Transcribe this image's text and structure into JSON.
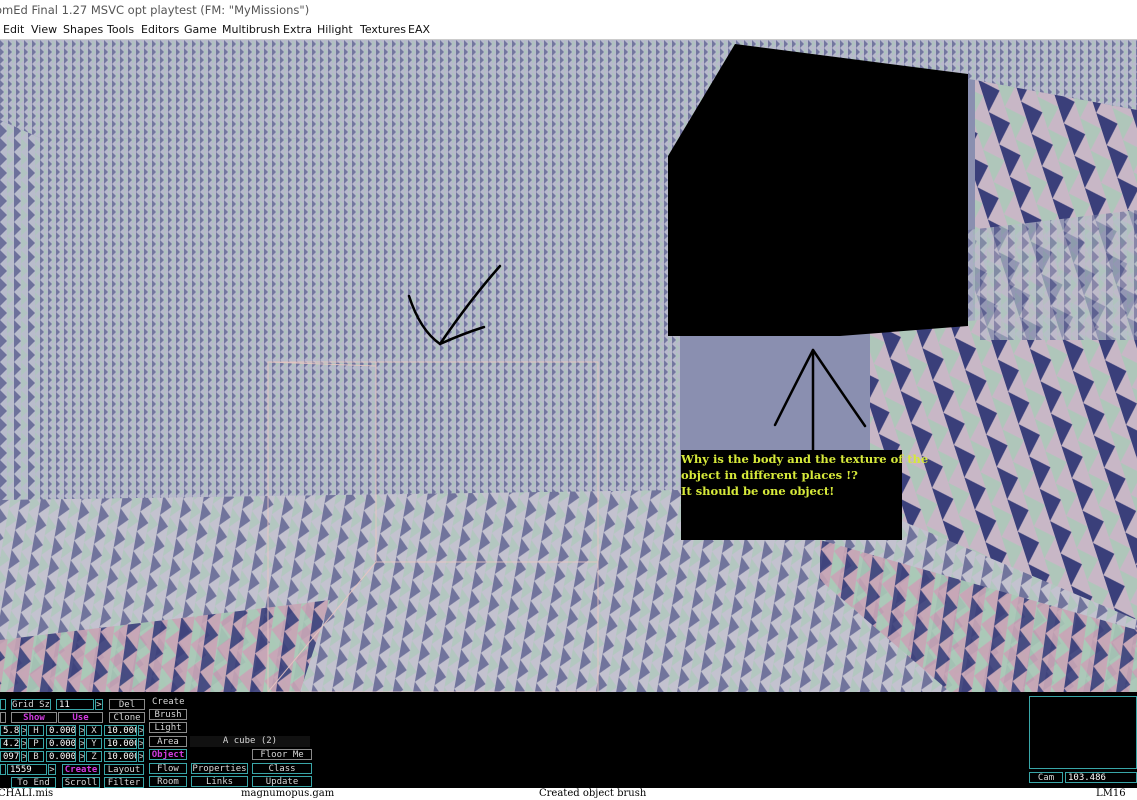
{
  "window": {
    "title": "omEd Final 1.27 MSVC opt playtest (FM: \"MyMissions\")"
  },
  "menu": [
    "Edit",
    "View",
    "Shapes",
    "Tools",
    "Editors",
    "Game",
    "Multibrush",
    "Extra",
    "Hilight",
    "Textures",
    "EAX"
  ],
  "annotation": {
    "line1": "Why is the body and the texture of the",
    "line2": "object in different places !?",
    "line3": "It should be one object!"
  },
  "panel": {
    "grid_label": "Grid Sz",
    "grid_value": "11",
    "del": "Del",
    "show": "Show",
    "use": "Use",
    "clone": "Clone",
    "pos_x": "5.827",
    "pos_y": "4.20",
    "pos_z": "097",
    "rot_h": "0.000",
    "rot_p": "0.000",
    "rot_b": "0.000",
    "rot_h_label": "H",
    "rot_p_label": "P",
    "rot_b_label": "B",
    "scale_x": "10.000",
    "scale_y": "10.000",
    "scale_z": "10.000",
    "scale_x_label": "X",
    "scale_y_label": "Y",
    "scale_z_label": "Z",
    "arrow": ">",
    "brush_num": "1559",
    "create_top": "Create",
    "brush": "Brush",
    "light": "Light",
    "area": "Area",
    "object": "Object",
    "brush_name": "A cube (2)",
    "floor_me": "Floor Me",
    "to_end": "To End",
    "scroll": "Scroll",
    "create": "Create",
    "filter": "Filter",
    "layout": "Layout",
    "flow": "Flow",
    "room": "Room",
    "properties": "Properties",
    "links": "Links",
    "class": "Class",
    "update": "Update",
    "cam_label": "Cam",
    "cam_value": "103.486"
  },
  "status": {
    "file": "CHALI.mis",
    "gam": "magnumopus.gam",
    "message": "Created object brush",
    "lm": "LM16"
  },
  "colors": {
    "wall_blue": "#8a8fb0",
    "tri_navy": "#3a3f7a",
    "tri_green": "#a9c9b6",
    "tri_pink": "#c7a4b4",
    "note_text": "#d6e93a",
    "panel_teal": "#39a6a8",
    "panel_magenta": "#d23be0"
  }
}
